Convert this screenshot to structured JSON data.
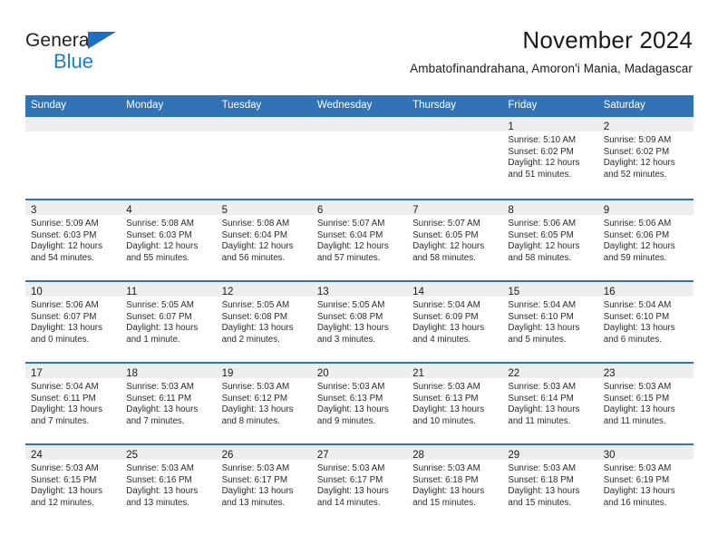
{
  "brand": {
    "name_top": "General",
    "name_bottom": "Blue",
    "triangle_icon": "triangle-icon",
    "color_dark": "#231f20",
    "color_blue": "#1f7ec9"
  },
  "header": {
    "title": "November 2024",
    "subtitle": "Ambatofinandrahana, Amoron'i Mania, Madagascar"
  },
  "theme": {
    "header_blue": "#3273b5",
    "daynum_band": "#eeeeee",
    "text": "#2b2b2b"
  },
  "weekdays": [
    "Sunday",
    "Monday",
    "Tuesday",
    "Wednesday",
    "Thursday",
    "Friday",
    "Saturday"
  ],
  "weeks": [
    [
      {
        "day": "",
        "empty": true
      },
      {
        "day": "",
        "empty": true
      },
      {
        "day": "",
        "empty": true
      },
      {
        "day": "",
        "empty": true
      },
      {
        "day": "",
        "empty": true
      },
      {
        "day": "1",
        "sunrise": "Sunrise: 5:10 AM",
        "sunset": "Sunset: 6:02 PM",
        "daylight_1": "Daylight: 12 hours",
        "daylight_2": "and 51 minutes."
      },
      {
        "day": "2",
        "sunrise": "Sunrise: 5:09 AM",
        "sunset": "Sunset: 6:02 PM",
        "daylight_1": "Daylight: 12 hours",
        "daylight_2": "and 52 minutes."
      }
    ],
    [
      {
        "day": "3",
        "sunrise": "Sunrise: 5:09 AM",
        "sunset": "Sunset: 6:03 PM",
        "daylight_1": "Daylight: 12 hours",
        "daylight_2": "and 54 minutes."
      },
      {
        "day": "4",
        "sunrise": "Sunrise: 5:08 AM",
        "sunset": "Sunset: 6:03 PM",
        "daylight_1": "Daylight: 12 hours",
        "daylight_2": "and 55 minutes."
      },
      {
        "day": "5",
        "sunrise": "Sunrise: 5:08 AM",
        "sunset": "Sunset: 6:04 PM",
        "daylight_1": "Daylight: 12 hours",
        "daylight_2": "and 56 minutes."
      },
      {
        "day": "6",
        "sunrise": "Sunrise: 5:07 AM",
        "sunset": "Sunset: 6:04 PM",
        "daylight_1": "Daylight: 12 hours",
        "daylight_2": "and 57 minutes."
      },
      {
        "day": "7",
        "sunrise": "Sunrise: 5:07 AM",
        "sunset": "Sunset: 6:05 PM",
        "daylight_1": "Daylight: 12 hours",
        "daylight_2": "and 58 minutes."
      },
      {
        "day": "8",
        "sunrise": "Sunrise: 5:06 AM",
        "sunset": "Sunset: 6:05 PM",
        "daylight_1": "Daylight: 12 hours",
        "daylight_2": "and 58 minutes."
      },
      {
        "day": "9",
        "sunrise": "Sunrise: 5:06 AM",
        "sunset": "Sunset: 6:06 PM",
        "daylight_1": "Daylight: 12 hours",
        "daylight_2": "and 59 minutes."
      }
    ],
    [
      {
        "day": "10",
        "sunrise": "Sunrise: 5:06 AM",
        "sunset": "Sunset: 6:07 PM",
        "daylight_1": "Daylight: 13 hours",
        "daylight_2": "and 0 minutes."
      },
      {
        "day": "11",
        "sunrise": "Sunrise: 5:05 AM",
        "sunset": "Sunset: 6:07 PM",
        "daylight_1": "Daylight: 13 hours",
        "daylight_2": "and 1 minute."
      },
      {
        "day": "12",
        "sunrise": "Sunrise: 5:05 AM",
        "sunset": "Sunset: 6:08 PM",
        "daylight_1": "Daylight: 13 hours",
        "daylight_2": "and 2 minutes."
      },
      {
        "day": "13",
        "sunrise": "Sunrise: 5:05 AM",
        "sunset": "Sunset: 6:08 PM",
        "daylight_1": "Daylight: 13 hours",
        "daylight_2": "and 3 minutes."
      },
      {
        "day": "14",
        "sunrise": "Sunrise: 5:04 AM",
        "sunset": "Sunset: 6:09 PM",
        "daylight_1": "Daylight: 13 hours",
        "daylight_2": "and 4 minutes."
      },
      {
        "day": "15",
        "sunrise": "Sunrise: 5:04 AM",
        "sunset": "Sunset: 6:10 PM",
        "daylight_1": "Daylight: 13 hours",
        "daylight_2": "and 5 minutes."
      },
      {
        "day": "16",
        "sunrise": "Sunrise: 5:04 AM",
        "sunset": "Sunset: 6:10 PM",
        "daylight_1": "Daylight: 13 hours",
        "daylight_2": "and 6 minutes."
      }
    ],
    [
      {
        "day": "17",
        "sunrise": "Sunrise: 5:04 AM",
        "sunset": "Sunset: 6:11 PM",
        "daylight_1": "Daylight: 13 hours",
        "daylight_2": "and 7 minutes."
      },
      {
        "day": "18",
        "sunrise": "Sunrise: 5:03 AM",
        "sunset": "Sunset: 6:11 PM",
        "daylight_1": "Daylight: 13 hours",
        "daylight_2": "and 7 minutes."
      },
      {
        "day": "19",
        "sunrise": "Sunrise: 5:03 AM",
        "sunset": "Sunset: 6:12 PM",
        "daylight_1": "Daylight: 13 hours",
        "daylight_2": "and 8 minutes."
      },
      {
        "day": "20",
        "sunrise": "Sunrise: 5:03 AM",
        "sunset": "Sunset: 6:13 PM",
        "daylight_1": "Daylight: 13 hours",
        "daylight_2": "and 9 minutes."
      },
      {
        "day": "21",
        "sunrise": "Sunrise: 5:03 AM",
        "sunset": "Sunset: 6:13 PM",
        "daylight_1": "Daylight: 13 hours",
        "daylight_2": "and 10 minutes."
      },
      {
        "day": "22",
        "sunrise": "Sunrise: 5:03 AM",
        "sunset": "Sunset: 6:14 PM",
        "daylight_1": "Daylight: 13 hours",
        "daylight_2": "and 11 minutes."
      },
      {
        "day": "23",
        "sunrise": "Sunrise: 5:03 AM",
        "sunset": "Sunset: 6:15 PM",
        "daylight_1": "Daylight: 13 hours",
        "daylight_2": "and 11 minutes."
      }
    ],
    [
      {
        "day": "24",
        "sunrise": "Sunrise: 5:03 AM",
        "sunset": "Sunset: 6:15 PM",
        "daylight_1": "Daylight: 13 hours",
        "daylight_2": "and 12 minutes."
      },
      {
        "day": "25",
        "sunrise": "Sunrise: 5:03 AM",
        "sunset": "Sunset: 6:16 PM",
        "daylight_1": "Daylight: 13 hours",
        "daylight_2": "and 13 minutes."
      },
      {
        "day": "26",
        "sunrise": "Sunrise: 5:03 AM",
        "sunset": "Sunset: 6:17 PM",
        "daylight_1": "Daylight: 13 hours",
        "daylight_2": "and 13 minutes."
      },
      {
        "day": "27",
        "sunrise": "Sunrise: 5:03 AM",
        "sunset": "Sunset: 6:17 PM",
        "daylight_1": "Daylight: 13 hours",
        "daylight_2": "and 14 minutes."
      },
      {
        "day": "28",
        "sunrise": "Sunrise: 5:03 AM",
        "sunset": "Sunset: 6:18 PM",
        "daylight_1": "Daylight: 13 hours",
        "daylight_2": "and 15 minutes."
      },
      {
        "day": "29",
        "sunrise": "Sunrise: 5:03 AM",
        "sunset": "Sunset: 6:18 PM",
        "daylight_1": "Daylight: 13 hours",
        "daylight_2": "and 15 minutes."
      },
      {
        "day": "30",
        "sunrise": "Sunrise: 5:03 AM",
        "sunset": "Sunset: 6:19 PM",
        "daylight_1": "Daylight: 13 hours",
        "daylight_2": "and 16 minutes."
      }
    ]
  ]
}
